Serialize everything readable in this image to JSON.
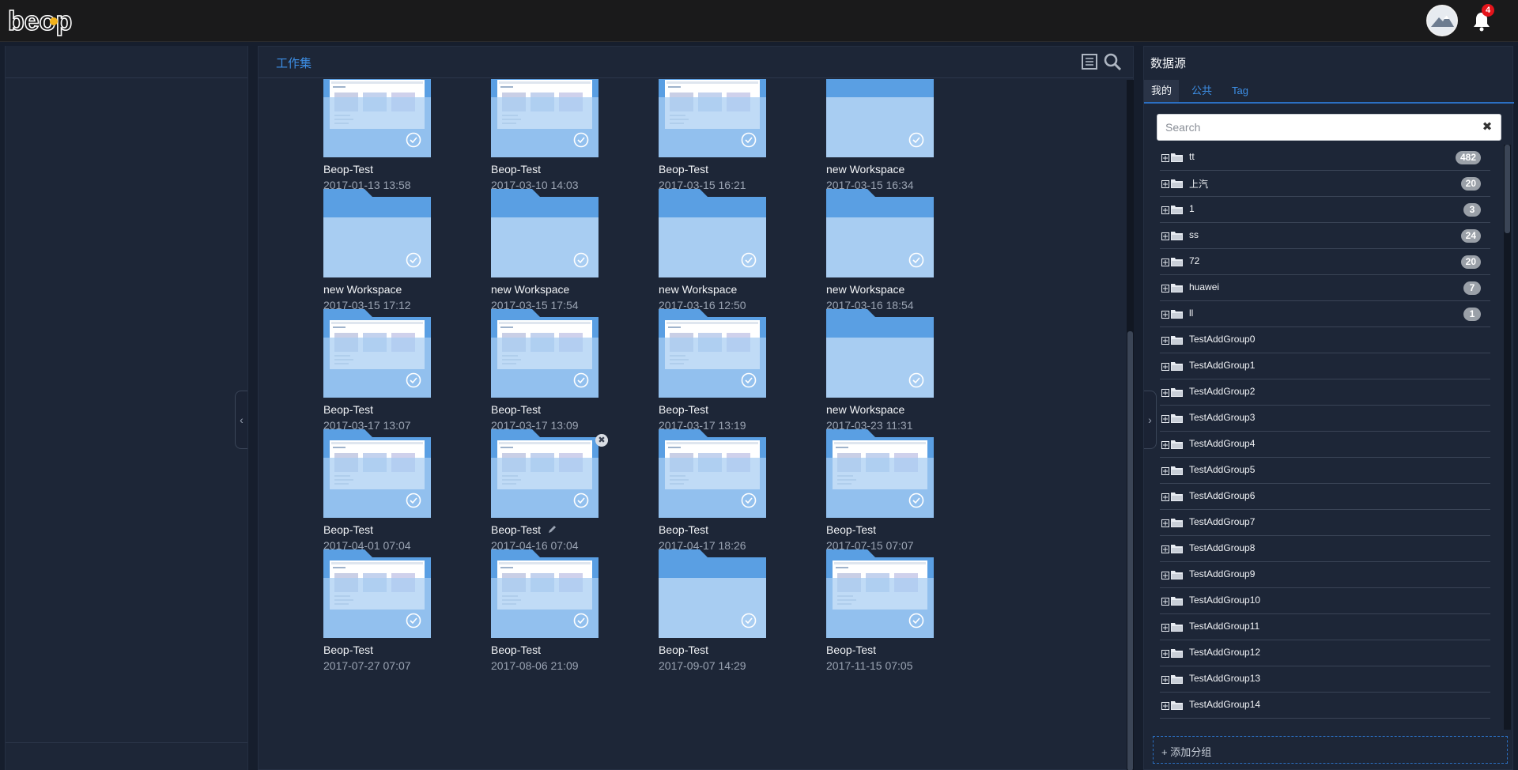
{
  "header": {
    "logo_text": "beop",
    "notification_count": "4"
  },
  "workspace": {
    "title": "工作集",
    "items": [
      {
        "name": "Beop-Test",
        "date": "2017-01-13 13:58",
        "kind": "preview"
      },
      {
        "name": "Beop-Test",
        "date": "2017-03-10 14:03",
        "kind": "preview"
      },
      {
        "name": "Beop-Test",
        "date": "2017-03-15 16:21",
        "kind": "preview"
      },
      {
        "name": "new Workspace",
        "date": "2017-03-15 16:34",
        "kind": "empty"
      },
      {
        "name": "new Workspace",
        "date": "2017-03-15 17:12",
        "kind": "empty"
      },
      {
        "name": "new Workspace",
        "date": "2017-03-15 17:54",
        "kind": "empty"
      },
      {
        "name": "new Workspace",
        "date": "2017-03-16 12:50",
        "kind": "empty"
      },
      {
        "name": "new Workspace",
        "date": "2017-03-16 18:54",
        "kind": "empty"
      },
      {
        "name": "Beop-Test",
        "date": "2017-03-17 13:07",
        "kind": "preview"
      },
      {
        "name": "Beop-Test",
        "date": "2017-03-17 13:09",
        "kind": "preview"
      },
      {
        "name": "Beop-Test",
        "date": "2017-03-17 13:19",
        "kind": "preview"
      },
      {
        "name": "new Workspace",
        "date": "2017-03-23 11:31",
        "kind": "empty"
      },
      {
        "name": "Beop-Test",
        "date": "2017-04-01 07:04",
        "kind": "preview"
      },
      {
        "name": "Beop-Test",
        "date": "2017-04-16 07:04",
        "kind": "preview",
        "hovered": true
      },
      {
        "name": "Beop-Test",
        "date": "2017-04-17 18:26",
        "kind": "preview"
      },
      {
        "name": "Beop-Test",
        "date": "2017-07-15 07:07",
        "kind": "preview"
      },
      {
        "name": "Beop-Test",
        "date": "2017-07-27 07:07",
        "kind": "preview"
      },
      {
        "name": "Beop-Test",
        "date": "2017-08-06 21:09",
        "kind": "preview"
      },
      {
        "name": "Beop-Test",
        "date": "2017-09-07 14:29",
        "kind": "empty"
      },
      {
        "name": "Beop-Test",
        "date": "2017-11-15 07:05",
        "kind": "preview"
      }
    ]
  },
  "datasource": {
    "title": "数据源",
    "tabs": [
      "我的",
      "公共",
      "Tag"
    ],
    "active_tab": 0,
    "search_placeholder": "Search",
    "groups": [
      {
        "label": "tt",
        "count": "482"
      },
      {
        "label": "上汽",
        "count": "20"
      },
      {
        "label": "1",
        "count": "3"
      },
      {
        "label": "ss",
        "count": "24"
      },
      {
        "label": "72",
        "count": "20"
      },
      {
        "label": "huawei",
        "count": "7"
      },
      {
        "label": "ll",
        "count": "1"
      },
      {
        "label": "TestAddGroup0",
        "count": ""
      },
      {
        "label": "TestAddGroup1",
        "count": ""
      },
      {
        "label": "TestAddGroup2",
        "count": ""
      },
      {
        "label": "TestAddGroup3",
        "count": ""
      },
      {
        "label": "TestAddGroup4",
        "count": ""
      },
      {
        "label": "TestAddGroup5",
        "count": ""
      },
      {
        "label": "TestAddGroup6",
        "count": ""
      },
      {
        "label": "TestAddGroup7",
        "count": ""
      },
      {
        "label": "TestAddGroup8",
        "count": ""
      },
      {
        "label": "TestAddGroup9",
        "count": ""
      },
      {
        "label": "TestAddGroup10",
        "count": ""
      },
      {
        "label": "TestAddGroup11",
        "count": ""
      },
      {
        "label": "TestAddGroup12",
        "count": ""
      },
      {
        "label": "TestAddGroup13",
        "count": ""
      },
      {
        "label": "TestAddGroup14",
        "count": ""
      }
    ],
    "add_group_label": "+ 添加分组"
  },
  "colors": {
    "accent": "#3d8fe6",
    "folder_back": "#5a9fe3",
    "folder_front": "#a8cdf2",
    "panel_bg": "#1d2637"
  }
}
